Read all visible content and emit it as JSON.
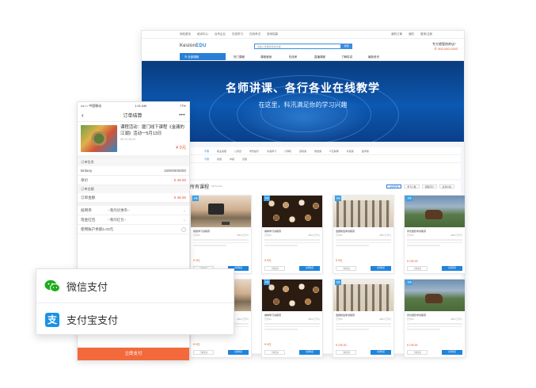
{
  "desktop": {
    "topbar": {
      "left": [
        "网站首页",
        "培训中心",
        "合作企业",
        "在线学习",
        "在线考试",
        "讲师招募"
      ],
      "right": [
        "我的订单",
        "我的",
        "登录/注册"
      ]
    },
    "header": {
      "logo_main": "Keslon",
      "logo_suffix": "EDU",
      "search_placeholder": "请输入您要搜索的内容",
      "search_button": "搜索",
      "hotline_label": "专方就管热库店！",
      "hotline_number": "400-000-0263"
    },
    "nav": {
      "all": "全部课程",
      "items": [
        "热门课程",
        "课程营销",
        "在线考",
        "直播课程",
        "了解讲讲",
        "最新资讯"
      ]
    },
    "banner": {
      "title": "名师讲课、各行各业在线教学",
      "subtitle": "在这里，科汛满足你的学习兴趣"
    },
    "filters": {
      "row1": [
        "不限",
        "职业技能",
        "公务员",
        "学历提升",
        "外语学习",
        "计算机",
        "建筑类",
        "财经类",
        "IT互联网",
        "外贸类",
        "医学类"
      ],
      "row2": [
        "不限",
        "初级",
        "中级",
        "高级"
      ],
      "tag1": "分类",
      "tag2": "级别"
    },
    "courses": {
      "title": "所有课程",
      "subtitle": "All Course",
      "sorts": [
        "最新开课",
        "学习人数",
        "课程评分",
        "最新价格"
      ],
      "cards": [
        {
          "badge": "直播",
          "name": "视频学习训练营",
          "meta_left": "已学8人",
          "meta_right": "285人已学习",
          "price": "¥ 0元",
          "btn_left": "了解更多",
          "btn_right": "立即购买",
          "img": "camera"
        },
        {
          "badge": "直播",
          "name": "咖啡学习训练营",
          "meta_left": "已学9人",
          "meta_right": "285人已学习",
          "price": "¥ 0元",
          "btn_left": "了解更多",
          "btn_right": "立即购买",
          "img": "coffee"
        },
        {
          "badge": "直播",
          "name": "选题新班学训练营",
          "meta_left": "已学8人",
          "meta_right": "285人已学习",
          "price": "¥ 0元",
          "btn_left": "了解更多",
          "btn_right": "立即购买",
          "img": "building"
        },
        {
          "badge": "直播",
          "name": "风光摄影学训练营",
          "meta_left": "已学9人",
          "meta_right": "285人已学习",
          "price": "¥ 199.00",
          "btn_left": "了解更多",
          "btn_right": "立即购买",
          "img": "yak"
        },
        {
          "badge": "直播",
          "name": "视频学习训练营",
          "meta_left": "已学8人",
          "meta_right": "285人已学习",
          "price": "¥ 0元",
          "btn_left": "了解更多",
          "btn_right": "立即购买",
          "img": "camera"
        },
        {
          "badge": "直播",
          "name": "咖啡学习训练营",
          "meta_left": "已学9人",
          "meta_right": "285人已学习",
          "price": "¥ 0元",
          "btn_left": "了解更多",
          "btn_right": "立即购买",
          "img": "coffee"
        },
        {
          "badge": "直播",
          "name": "选题新班学训练营",
          "meta_left": "已学8人",
          "meta_right": "285人已学习",
          "price": "¥ 199.00",
          "btn_left": "了解更多",
          "btn_right": "立即购买",
          "img": "building"
        },
        {
          "badge": "直播",
          "name": "风光摄影学训练营",
          "meta_left": "已学9人",
          "meta_right": "285人已学习",
          "price": "¥ 199.00",
          "btn_left": "了解更多",
          "btn_right": "立即购买",
          "img": "yak"
        }
      ]
    }
  },
  "mobile": {
    "status": {
      "carrier": "•••○○ 中国移动",
      "time": "1:41 AM",
      "battery": "77%"
    },
    "title": "订单结算",
    "product": {
      "title": "课程活动：厦门线下课程《金庸的江湖》活动一5月13日",
      "date": "05-13 08:24",
      "price": "¥ 0元"
    },
    "order_info_label": "订单信息",
    "name_label": "Britany",
    "phone": "15000000000",
    "amount_label": "单价",
    "amount_value": "¥ 49.00",
    "order_amount_section": "订单金额",
    "order_total_label": "订单金额",
    "order_total_value": "¥ 49.00",
    "coupon_label": "抵用券",
    "coupon_value": "--我的优惠券--",
    "redpack_label": "现金红包",
    "redpack_value": "--我的红包--",
    "balance_label": "使用账户余额1.00元",
    "submit": "立即支付"
  },
  "pay": {
    "wechat": "微信支付",
    "alipay": "支付宝支付",
    "alipay_glyph": "支"
  },
  "colors": {
    "brand_blue": "#2a7fd4",
    "accent_orange": "#f26a3c",
    "price_red": "#e5502b",
    "wechat_green": "#1aad19",
    "alipay_blue": "#1a92e6"
  }
}
